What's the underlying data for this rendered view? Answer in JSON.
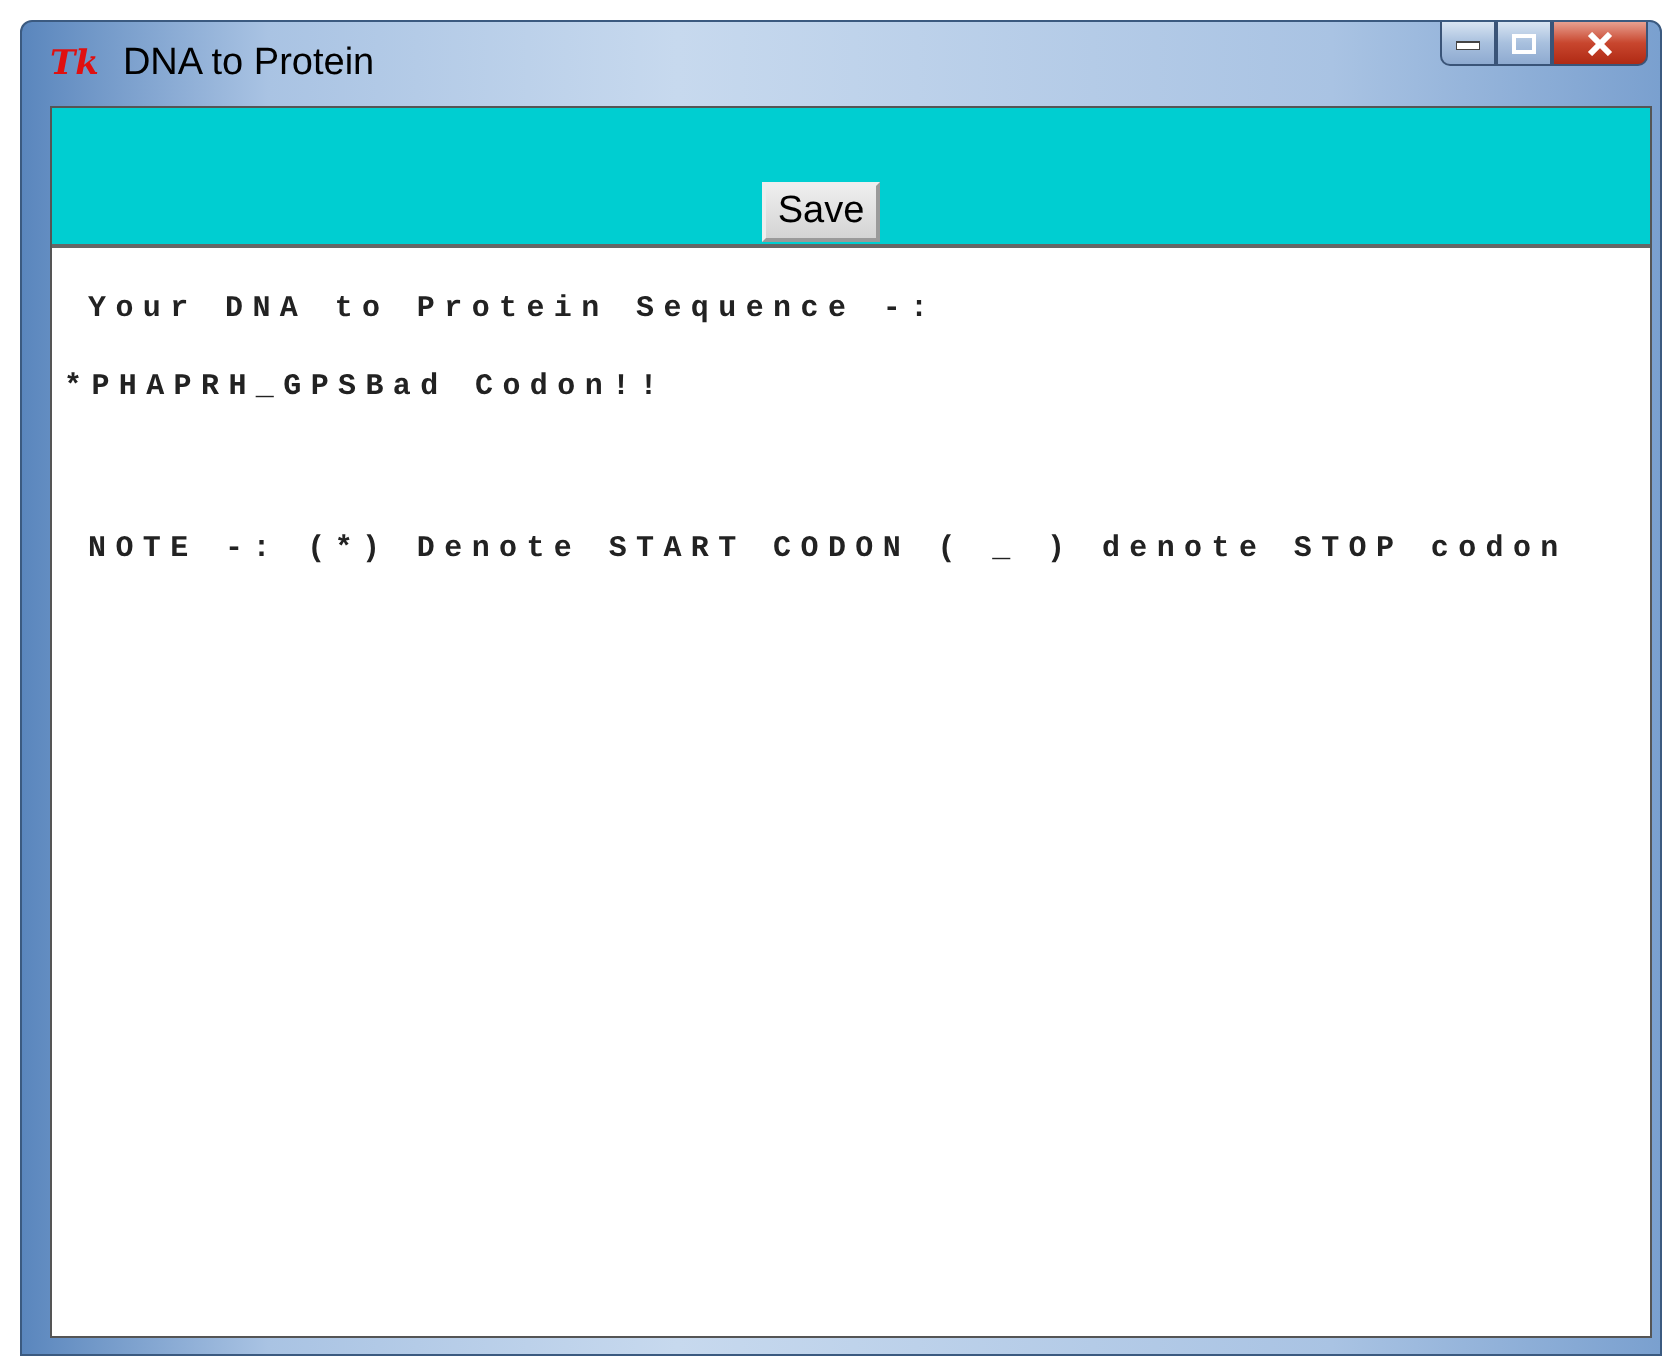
{
  "window": {
    "title": "DNA to Protein",
    "icon": "Tk"
  },
  "toolbar": {
    "buttons": [
      "Save"
    ]
  },
  "output": {
    "lines": [
      {
        "kind": "text",
        "text": "Your DNA to Protein Sequence -:"
      },
      {
        "kind": "text",
        "text": "*PHAPRH_GPSBad Codon!!"
      },
      {
        "kind": "blank"
      },
      {
        "kind": "text",
        "text": "NOTE -: (*) Denote START CODON ( _ ) denote STOP codon"
      }
    ]
  }
}
